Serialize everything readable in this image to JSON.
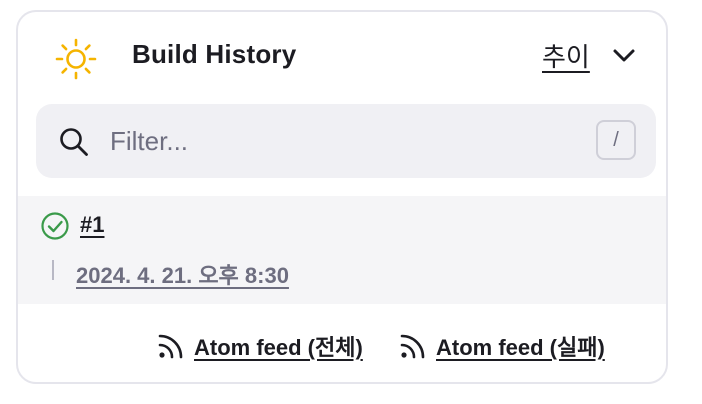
{
  "header": {
    "title": "Build History",
    "trend_label": "추이",
    "weather_icon": "sun-icon",
    "accent_color": "#f5b400"
  },
  "search": {
    "placeholder": "Filter...",
    "value": "",
    "shortcut": "/"
  },
  "builds": [
    {
      "number": "#1",
      "status": "success",
      "status_color": "#3a9a4a",
      "timestamp": "2024. 4. 21. 오후 8:30"
    }
  ],
  "feeds": {
    "all_label": "Atom feed (전체)",
    "failed_label": "Atom feed (실패)"
  }
}
